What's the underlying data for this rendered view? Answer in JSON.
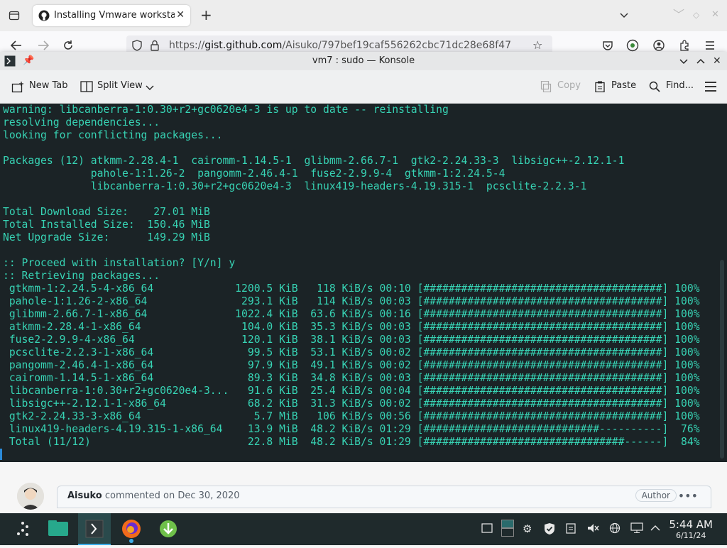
{
  "browser": {
    "tab_title": "Installing Vmware workstation",
    "url_prefix": "https://",
    "url_host": "gist.github.com",
    "url_path": "/Aisuko/797bef19caf556262cbc71dc28e68f47"
  },
  "konsole": {
    "title": "vm7 : sudo — Konsole",
    "toolbar": {
      "new_tab": "New Tab",
      "split_view": "Split View",
      "copy": "Copy",
      "paste": "Paste",
      "find": "Find..."
    },
    "terminal_lines": [
      "warning: libcanberra-1:0.30+r2+gc0620e4-3 is up to date -- reinstalling",
      "resolving dependencies...",
      "looking for conflicting packages...",
      "",
      "Packages (12) atkmm-2.28.4-1  cairomm-1.14.5-1  glibmm-2.66.7-1  gtk2-2.24.33-3  libsigc++-2.12.1-1",
      "              pahole-1:1.26-2  pangomm-2.46.4-1  fuse2-2.9.9-4  gtkmm-1:2.24.5-4",
      "              libcanberra-1:0.30+r2+gc0620e4-3  linux419-headers-4.19.315-1  pcsclite-2.2.3-1",
      "",
      "Total Download Size:    27.01 MiB",
      "Total Installed Size:  150.46 MiB",
      "Net Upgrade Size:      149.29 MiB",
      "",
      ":: Proceed with installation? [Y/n] y",
      ":: Retrieving packages...",
      " gtkmm-1:2.24.5-4-x86_64             1200.5 KiB   118 KiB/s 00:10 [######################################] 100%",
      " pahole-1:1.26-2-x86_64               293.1 KiB   114 KiB/s 00:03 [######################################] 100%",
      " glibmm-2.66.7-1-x86_64              1022.4 KiB  63.6 KiB/s 00:16 [######################################] 100%",
      " atkmm-2.28.4-1-x86_64                104.0 KiB  35.3 KiB/s 00:03 [######################################] 100%",
      " fuse2-2.9.9-4-x86_64                 120.1 KiB  38.1 KiB/s 00:03 [######################################] 100%",
      " pcsclite-2.2.3-1-x86_64               99.5 KiB  53.1 KiB/s 00:02 [######################################] 100%",
      " pangomm-2.46.4-1-x86_64               97.9 KiB  49.1 KiB/s 00:02 [######################################] 100%",
      " cairomm-1.14.5-1-x86_64               89.3 KiB  34.8 KiB/s 00:03 [######################################] 100%",
      " libcanberra-1:0.30+r2+gc0620e4-3...   91.6 KiB  25.4 KiB/s 00:04 [######################################] 100%",
      " libsigc++-2.12.1-1-x86_64             68.2 KiB  31.3 KiB/s 00:02 [######################################] 100%",
      " gtk2-2.24.33-3-x86_64                  5.7 MiB   106 KiB/s 00:56 [######################################] 100%",
      " linux419-headers-4.19.315-1-x86_64    13.9 MiB  48.2 KiB/s 01:29 [############################----------]  76%",
      " Total (11/12)                         22.8 MiB  48.2 KiB/s 01:29 [################################------]  84%"
    ]
  },
  "comment": {
    "author": "Aisuko",
    "action": "commented on Dec 30, 2020",
    "badge": "Author"
  },
  "taskbar": {
    "time": "5:44 AM",
    "date": "6/11/24"
  },
  "colors": {
    "terminal_text": "#37d3b4",
    "terminal_bg": "#1b2326",
    "accent": "#3daee9"
  }
}
